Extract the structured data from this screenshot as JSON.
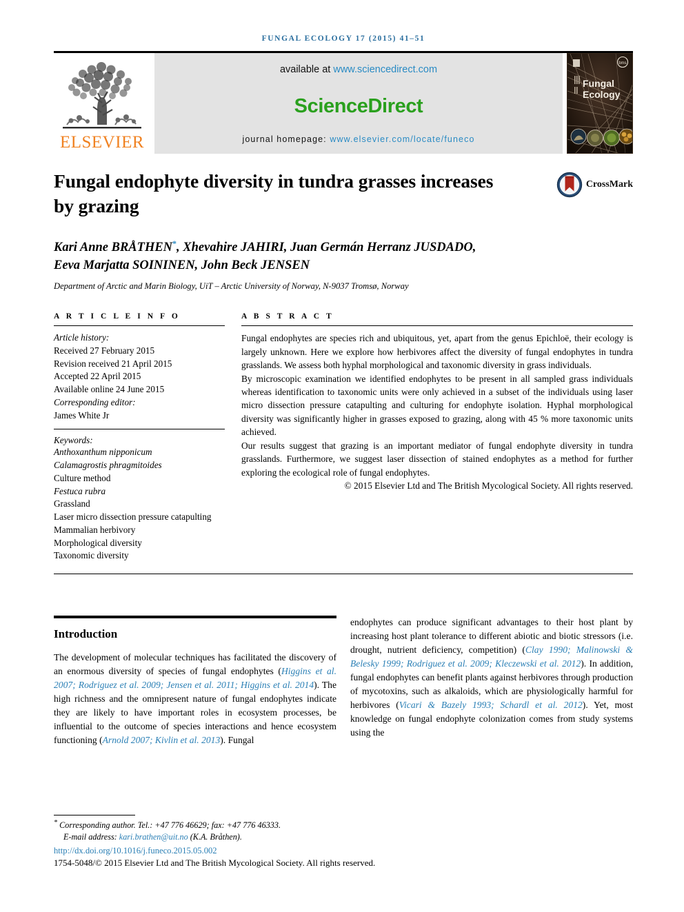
{
  "running_head": "FUNGAL ECOLOGY 17 (2015) 41–51",
  "masthead": {
    "publisher_name": "ELSEVIER",
    "available_prefix": "available at ",
    "available_url": "www.sciencedirect.com",
    "sciencedirect_logo": "ScienceDirect",
    "homepage_prefix": "journal homepage: ",
    "homepage_url": "www.elsevier.com/locate/funeco",
    "cover_title_line1": "Fungal",
    "cover_title_line2": "Ecology",
    "colors": {
      "elsevier_orange": "#f08222",
      "sciencedirect_green": "#2aa01e",
      "link_blue": "#2a8bc4",
      "panel_grey": "#e3e3e3",
      "running_head_blue": "#2a6e9e"
    }
  },
  "article": {
    "title": "Fungal endophyte diversity in tundra grasses increases by grazing",
    "crossmark_label": "CrossMark",
    "authors_line1": "Kari Anne BRÅTHEN",
    "authors_star": "*",
    "authors_line1_rest": ", Xhevahire JAHIRI, Juan Germán Herranz JUSDADO,",
    "authors_line2": "Eeva Marjatta SOININEN, John Beck JENSEN",
    "affiliation": "Department of Arctic and Marin Biology, UiT – Arctic University of Norway, N-9037 Tromsø, Norway"
  },
  "article_info": {
    "heading": "A R T I C L E   I N F O",
    "history_label": "Article history:",
    "history": [
      "Received 27 February 2015",
      "Revision received 21 April 2015",
      "Accepted 22 April 2015",
      "Available online 24 June 2015"
    ],
    "corresponding_editor_label": "Corresponding editor:",
    "corresponding_editor": "James White Jr",
    "keywords_label": "Keywords:",
    "keywords": [
      {
        "text": "Anthoxanthum nipponicum",
        "italic": true
      },
      {
        "text": "Calamagrostis phragmitoides",
        "italic": true
      },
      {
        "text": "Culture method",
        "italic": false
      },
      {
        "text": "Festuca rubra",
        "italic": true
      },
      {
        "text": "Grassland",
        "italic": false
      },
      {
        "text": "Laser micro dissection pressure catapulting",
        "italic": false
      },
      {
        "text": "Mammalian herbivory",
        "italic": false
      },
      {
        "text": "Morphological diversity",
        "italic": false
      },
      {
        "text": "Taxonomic diversity",
        "italic": false
      }
    ]
  },
  "abstract": {
    "heading": "A B S T R A C T",
    "paragraphs": [
      "Fungal endophytes are species rich and ubiquitous, yet, apart from the genus Epichloë, their ecology is largely unknown. Here we explore how herbivores affect the diversity of fungal endophytes in tundra grasslands. We assess both hyphal morphological and taxonomic diversity in grass individuals.",
      "By microscopic examination we identified endophytes to be present in all sampled grass individuals whereas identification to taxonomic units were only achieved in a subset of the individuals using laser micro dissection pressure catapulting and culturing for endophyte isolation. Hyphal morphological diversity was significantly higher in grasses exposed to grazing, along with 45 % more taxonomic units achieved.",
      "Our results suggest that grazing is an important mediator of fungal endophyte diversity in tundra grasslands. Furthermore, we suggest laser dissection of stained endophytes as a method for further exploring the ecological role of fungal endophytes."
    ],
    "italic_term": "Epichloë",
    "copyright": "© 2015 Elsevier Ltd and The British Mycological Society. All rights reserved."
  },
  "body": {
    "section_heading": "Introduction",
    "left_column": {
      "part1": "The development of molecular techniques has facilitated the discovery of an enormous diversity of species of fungal endophytes (",
      "cite1": "Higgins et al. 2007; Rodriguez et al. 2009; Jensen et al. 2011; Higgins et al. 2014",
      "part2": "). The high richness and the omnipresent nature of fungal endophytes indicate they are likely to have important roles in ecosystem processes, be influential to the outcome of species interactions and hence ecosystem functioning (",
      "cite2": "Arnold 2007; Kivlin et al. 2013",
      "part3": "). Fungal"
    },
    "right_column": {
      "part1": "endophytes can produce significant advantages to their host plant by increasing host plant tolerance to different abiotic and biotic stressors (i.e. drought, nutrient deficiency, competition) (",
      "cite1": "Clay 1990; Malinowski & Belesky 1999; Rodriguez et al. 2009; Kleczewski et al. 2012",
      "part2": "). In addition, fungal endophytes can benefit plants against herbivores through production of mycotoxins, such as alkaloids, which are physiologically harmful for herbivores (",
      "cite2": "Vicari & Bazely 1993; Schardl et al. 2012",
      "part3": "). Yet, most knowledge on fungal endophyte colonization comes from study systems using the"
    }
  },
  "footer": {
    "corresponding_marker": "*",
    "corresponding_text": "Corresponding author. Tel.: +47 776 46629; fax: +47 776 46333.",
    "email_label": "E-mail address: ",
    "email": "kari.brathen@uit.no",
    "email_suffix": " (K.A. Bråthen).",
    "doi": "http://dx.doi.org/10.1016/j.funeco.2015.05.002",
    "issn_line": "1754-5048/© 2015 Elsevier Ltd and The British Mycological Society. All rights reserved."
  }
}
